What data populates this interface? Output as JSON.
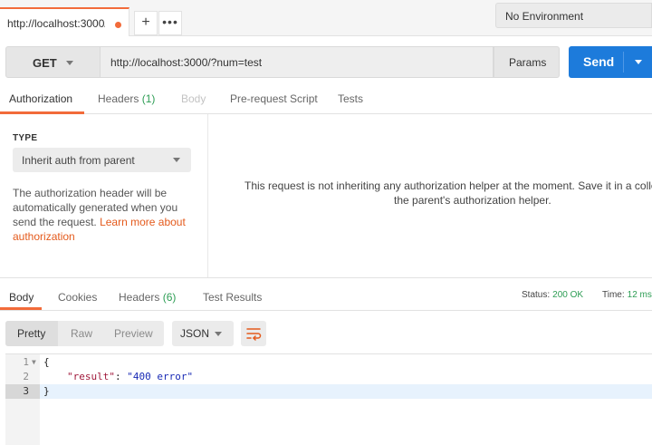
{
  "tabs": {
    "active_title": "http://localhost:3000/",
    "add_label": "+",
    "more_label": "•••"
  },
  "environment": {
    "selected": "No Environment"
  },
  "request": {
    "method": "GET",
    "url": "http://localhost:3000/?num=test",
    "params_label": "Params",
    "send_label": "Send"
  },
  "request_tabs": [
    {
      "label": "Authorization"
    },
    {
      "label": "Headers",
      "count": "(1)"
    },
    {
      "label": "Body"
    },
    {
      "label": "Pre-request Script"
    },
    {
      "label": "Tests"
    }
  ],
  "auth": {
    "type_label": "TYPE",
    "type_value": "Inherit auth from parent",
    "desc_text": "The authorization header will be automatically generated when you send the request. ",
    "desc_link": "Learn more about authorization",
    "message_line1": "This request is not inheriting any authorization helper at the moment. Save it in a collect",
    "message_line2": "the parent's authorization helper."
  },
  "response_tabs": [
    {
      "label": "Body"
    },
    {
      "label": "Cookies"
    },
    {
      "label": "Headers",
      "count": "(6)"
    },
    {
      "label": "Test Results"
    }
  ],
  "status": {
    "status_label": "Status:",
    "status_value": "200 OK",
    "time_label": "Time:",
    "time_value": "12 ms"
  },
  "format": {
    "modes": [
      "Pretty",
      "Raw",
      "Preview"
    ],
    "language": "JSON"
  },
  "editor": {
    "line_numbers": [
      "1",
      "2",
      "3"
    ],
    "line1": "{",
    "line2_key": "\"result\"",
    "line2_sep": ": ",
    "line2_value": "\"400 error\"",
    "line3": "}"
  },
  "colors": {
    "accent": "#f26b3a",
    "send": "#1d7bdb",
    "success": "#2d9d54",
    "link": "#e45a1c"
  }
}
